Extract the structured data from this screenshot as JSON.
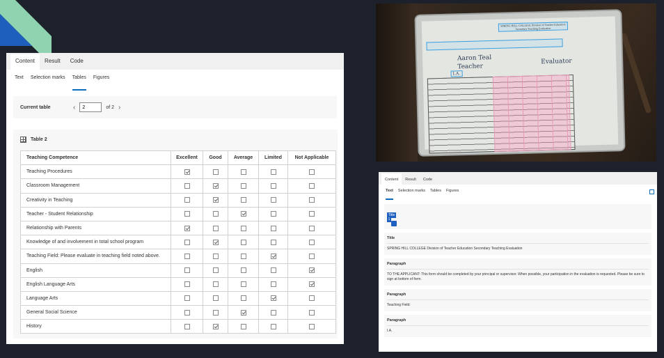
{
  "left_panel": {
    "tabs": [
      "Content",
      "Result",
      "Code"
    ],
    "subtabs": [
      "Text",
      "Selection marks",
      "Tables",
      "Figures"
    ],
    "current_table": {
      "label": "Current table",
      "value": "2",
      "of_label": "of 2"
    },
    "table_title": "Table 2",
    "columns": [
      "Teaching Competence",
      "Excellent",
      "Good",
      "Average",
      "Limited",
      "Not Applicable"
    ],
    "rows": [
      {
        "name": "Teaching Procedures",
        "checks": [
          true,
          false,
          false,
          false,
          false
        ]
      },
      {
        "name": "Classroom Management",
        "checks": [
          false,
          true,
          false,
          false,
          false
        ]
      },
      {
        "name": "Creativity in Teaching",
        "checks": [
          false,
          true,
          false,
          false,
          false
        ]
      },
      {
        "name": "Teacher - Student Relationship",
        "checks": [
          false,
          false,
          true,
          false,
          false
        ]
      },
      {
        "name": "Relationship with Parents",
        "checks": [
          true,
          false,
          false,
          false,
          false
        ]
      },
      {
        "name": "Knowledge of and involvement in total school program",
        "checks": [
          false,
          true,
          false,
          false,
          false
        ]
      },
      {
        "name": "Teaching Field: Please evaluate in teaching field noted above.",
        "checks": [
          false,
          false,
          false,
          true,
          false
        ]
      },
      {
        "name": "English",
        "checks": [
          false,
          false,
          false,
          false,
          true
        ]
      },
      {
        "name": "English Language Arts",
        "checks": [
          false,
          false,
          false,
          false,
          true
        ]
      },
      {
        "name": "Language Arts",
        "checks": [
          false,
          false,
          false,
          true,
          false
        ]
      },
      {
        "name": "General Social Science",
        "checks": [
          false,
          false,
          true,
          false,
          false
        ]
      },
      {
        "name": "History",
        "checks": [
          false,
          true,
          false,
          false,
          false
        ]
      }
    ]
  },
  "photo": {
    "doc_title": "SPRING HILL COLLEGE Division of Teacher Education Secondary Teaching Evaluation",
    "applicant_name": "Aaron Teal",
    "school": "Teacher",
    "evaluator": "Evaluator",
    "field": "I.A."
  },
  "right_panel": {
    "tabs": [
      "Content",
      "Result",
      "Code"
    ],
    "subtabs": [
      "Text",
      "Selection marks",
      "Tables",
      "Figures"
    ],
    "selected_label": "Title",
    "selected_mark": "1",
    "blocks": [
      {
        "type": "Title",
        "text": "SPRING HILL COLLEGE Division of Teacher Education Secondary Teaching Evaluation"
      },
      {
        "type": "Paragraph",
        "text": "TO THE APPLICANT: This form should be completed by your principal or supervisor. When possible, your participation in the evaluation is requested. Please be sure to sign at bottom of form."
      },
      {
        "type": "Paragraph",
        "text": "Teaching Field:"
      },
      {
        "type": "Paragraph",
        "text": "I.A."
      }
    ]
  },
  "colors": {
    "background": "#1d212b",
    "accent": "#0f6cbd",
    "highlight": "#1f5fbf",
    "deco_green": "#8fd3b0",
    "deco_blue": "#1e5fbe"
  }
}
